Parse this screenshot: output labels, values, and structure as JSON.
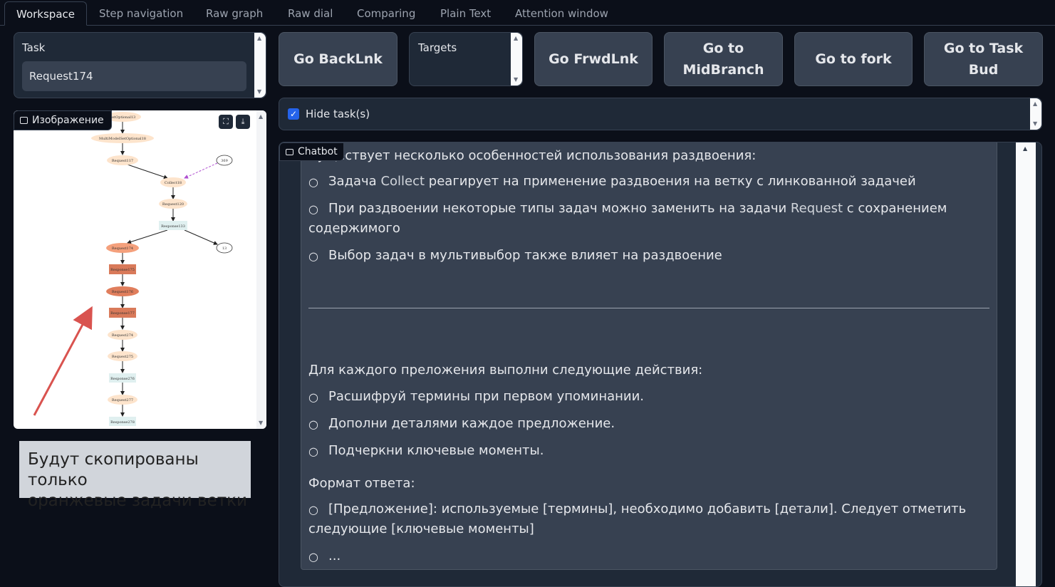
{
  "tabs": [
    "Workspace",
    "Step navigation",
    "Raw graph",
    "Raw dial",
    "Comparing",
    "Plain Text",
    "Attention window"
  ],
  "task": {
    "label": "Task",
    "value": "Request174"
  },
  "targets": {
    "label": "Targets"
  },
  "buttons": {
    "back": "Go BackLnk",
    "forward": "Go FrwdLnk",
    "midbranch_1": "Go to",
    "midbranch_2": "MidBranch",
    "fork": "Go to fork",
    "taskbud_1": "Go to Task",
    "taskbud_2": "Bud"
  },
  "hide_tasks": {
    "label": "Hide task(s)",
    "checked": true
  },
  "image": {
    "label": "Изображение",
    "nodes": [
      "SetOptional13",
      "MultiModelSetOptional18",
      "Request117",
      "369",
      "Collect18",
      "Request120",
      "Response133",
      "Request174",
      "Response175",
      "Request176",
      "Response177",
      "Request274",
      "Request275",
      "Response276",
      "Request277",
      "Response278",
      "13"
    ]
  },
  "caption": {
    "line1": "Будут скопированы только",
    "line2": "оранжевые задачи ветки"
  },
  "chat": {
    "label": "Chatbot",
    "intro": "Существует несколько особенностей использования раздвоения:",
    "bullet1_a": "Задача ",
    "bullet1_b": "Collect",
    "bullet1_c": " реагирует на применение раздвоения на ветку с линкованной задачей",
    "bullet2_a": "При раздвоении некоторые типы задач можно заменить на задачи ",
    "bullet2_b": "Request",
    "bullet2_c": " с сохранением",
    "bullet2_cont": "содержимого",
    "bullet3": "Выбор задач в мультивыбор также влияет на раздвоение",
    "actions_intro": "Для каждого преложения выполни следующие действия:",
    "action1": "Расшифруй термины при первом упоминании.",
    "action2": "Дополни деталями каждое предложение.",
    "action3": "Подчеркни ключевые моменты.",
    "format_label": "Формат ответа:",
    "format1": "[Предложение]: используемые [термины], необходимо добавить [детали]. Следует отметить",
    "format1_cont": "следующие [ключевые моменты]",
    "format2": "..."
  },
  "colors": {
    "orange_task": "#e8956a",
    "orange_dark": "#c96f52",
    "light_task": "#fde4cc",
    "response": "#e0f0f0",
    "arrow": "#d9534f"
  }
}
